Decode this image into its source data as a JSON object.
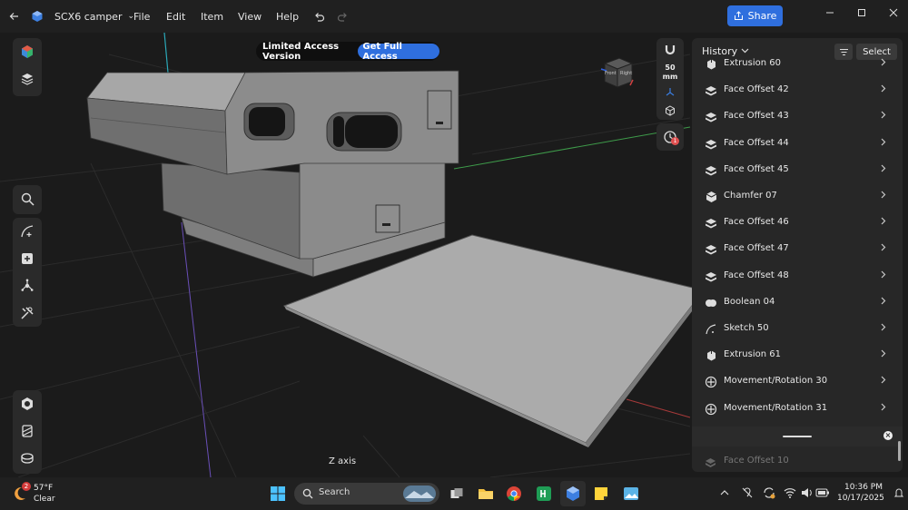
{
  "window": {
    "back_icon": "back-arrow-icon",
    "app_icon": "shapr3d-icon",
    "document_title": "SCX6 camper",
    "menus": [
      "File",
      "Edit",
      "Item",
      "View",
      "Help"
    ],
    "share_label": "Share"
  },
  "viewport": {
    "banner_label": "Limited Access Version",
    "banner_cta": "Get Full Access",
    "measure_value": "50",
    "measure_unit": "mm",
    "axis_label": "Z axis",
    "view_cube_faces": [
      "Front",
      "Right"
    ],
    "notification_badge": "1"
  },
  "history": {
    "title": "History",
    "select_label": "Select",
    "items": [
      {
        "label": "Extrusion 60",
        "icon": "extrusion-icon"
      },
      {
        "label": "Face Offset 42",
        "icon": "face-offset-icon"
      },
      {
        "label": "Face Offset 43",
        "icon": "face-offset-icon"
      },
      {
        "label": "Face Offset 44",
        "icon": "face-offset-icon"
      },
      {
        "label": "Face Offset 45",
        "icon": "face-offset-icon"
      },
      {
        "label": "Chamfer 07",
        "icon": "chamfer-icon"
      },
      {
        "label": "Face Offset 46",
        "icon": "face-offset-icon"
      },
      {
        "label": "Face Offset 47",
        "icon": "face-offset-icon"
      },
      {
        "label": "Face Offset 48",
        "icon": "face-offset-icon"
      },
      {
        "label": "Boolean 04",
        "icon": "boolean-icon"
      },
      {
        "label": "Sketch 50",
        "icon": "sketch-icon"
      },
      {
        "label": "Extrusion 61",
        "icon": "extrusion-icon"
      },
      {
        "label": "Movement/Rotation 30",
        "icon": "movement-rotation-icon"
      },
      {
        "label": "Movement/Rotation 31",
        "icon": "movement-rotation-icon"
      }
    ],
    "faded_item": "Face Offset 10"
  },
  "taskbar": {
    "weather_badge": "2",
    "temperature": "57°F",
    "condition": "Clear",
    "search_placeholder": "Search",
    "time": "10:36 PM",
    "date": "10/17/2025"
  },
  "colors": {
    "accent": "#2f6fde",
    "panel": "#272727",
    "titlebar": "#202020"
  }
}
